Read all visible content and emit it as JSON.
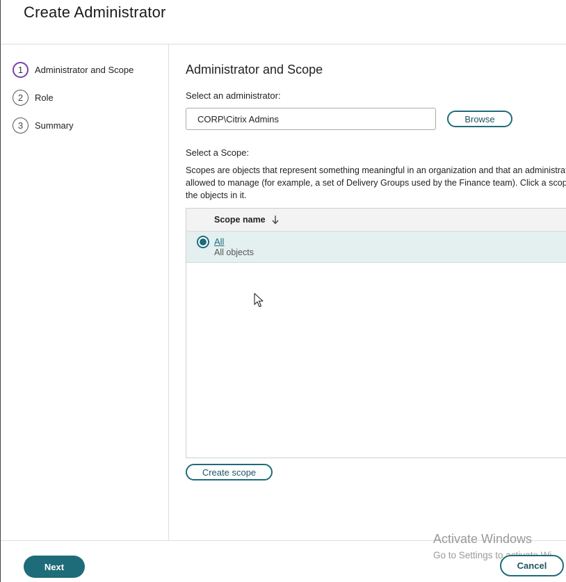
{
  "dialog": {
    "title": "Create Administrator"
  },
  "steps": [
    {
      "number": "1",
      "label": "Administrator and Scope",
      "active": true
    },
    {
      "number": "2",
      "label": "Role",
      "active": false
    },
    {
      "number": "3",
      "label": "Summary",
      "active": false
    }
  ],
  "main": {
    "section_title": "Administrator and Scope",
    "admin_label": "Select an administrator:",
    "admin_value": "CORP\\Citrix Admins",
    "browse_label": "Browse",
    "scope_label": "Select a Scope:",
    "scope_description": [
      "Scopes are objects that represent something meaningful in an organization and that an administrat",
      "allowed to manage (for example, a set of Delivery Groups used by the Finance team). Click a scope",
      "the objects in it."
    ],
    "table": {
      "column_header": "Scope name",
      "sort": "descending",
      "rows": [
        {
          "name": "All",
          "description": "All objects",
          "selected": true
        }
      ]
    },
    "create_scope_label": "Create scope"
  },
  "footer": {
    "next_label": "Next",
    "cancel_label": "Cancel"
  },
  "watermark": {
    "line1": "Activate Windows",
    "line2": "Go to Settings to activate Wi"
  },
  "colors": {
    "accent": "#1e6b7a",
    "active_step": "#7b3fb0",
    "selected_row": "#e3f0ef"
  }
}
